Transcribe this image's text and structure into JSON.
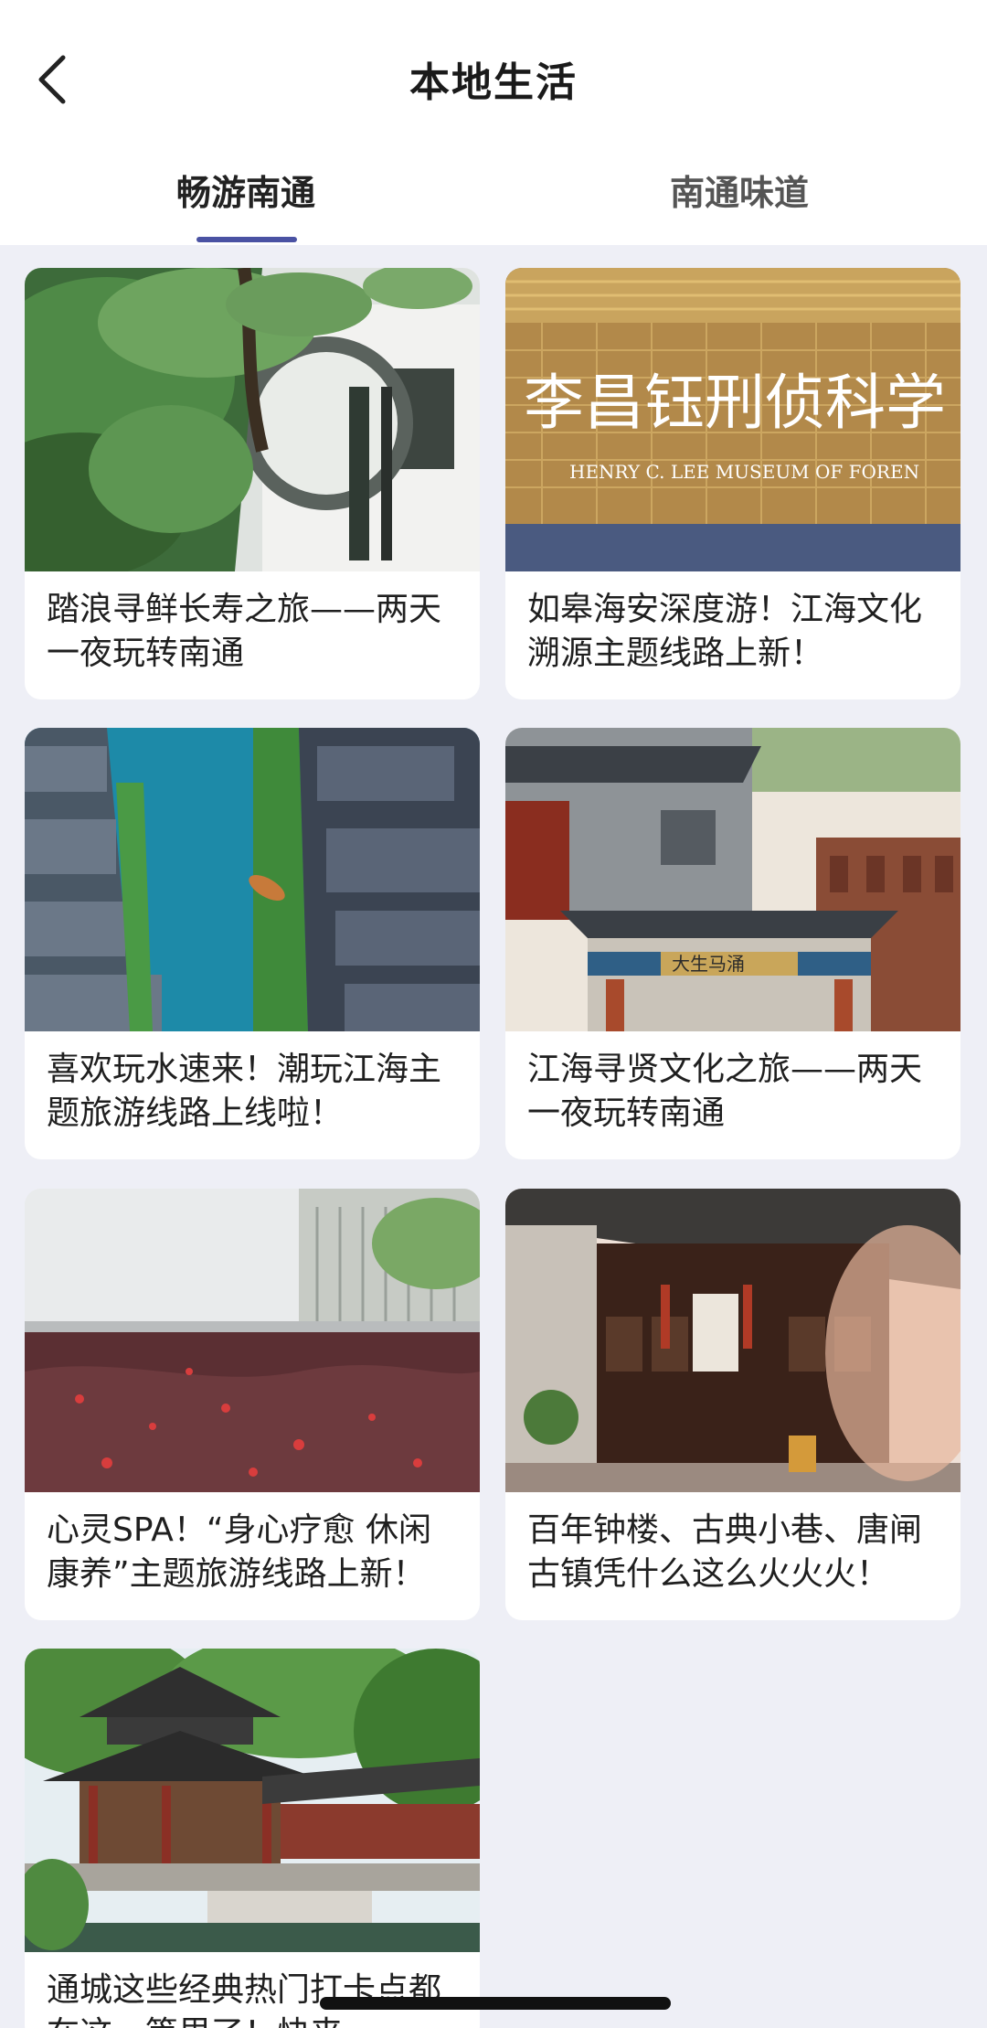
{
  "header": {
    "title": "本地生活",
    "back_icon": "chevron-left-icon"
  },
  "tabs": [
    {
      "label": "畅游南通",
      "active": true
    },
    {
      "label": "南通味道",
      "active": false
    }
  ],
  "colors": {
    "accent": "#4a52a3",
    "background": "#eeeff6",
    "card": "#ffffff"
  },
  "cards": [
    {
      "title": "踏浪寻鲜长寿之旅——两天一夜玩转南通"
    },
    {
      "title": "如皋海安深度游！江海文化溯源主题线路上新！",
      "image_text": "李昌钰刑侦科学",
      "image_subtext": "HENRY C. LEE MUSEUM OF FOREN"
    },
    {
      "title": "喜欢玩水速来！潮玩江海主题旅游线路上线啦！"
    },
    {
      "title": "江海寻贤文化之旅——两天一夜玩转南通",
      "image_text": "大生马涌"
    },
    {
      "title": "心灵SPA！“身心疗愈 休闲康养”主题旅游线路上新！"
    },
    {
      "title": "百年钟楼、古典小巷、唐闸古镇凭什么这么火火火！"
    },
    {
      "title": "通城这些经典热门打卡点都在这一篇里了！快来"
    }
  ]
}
